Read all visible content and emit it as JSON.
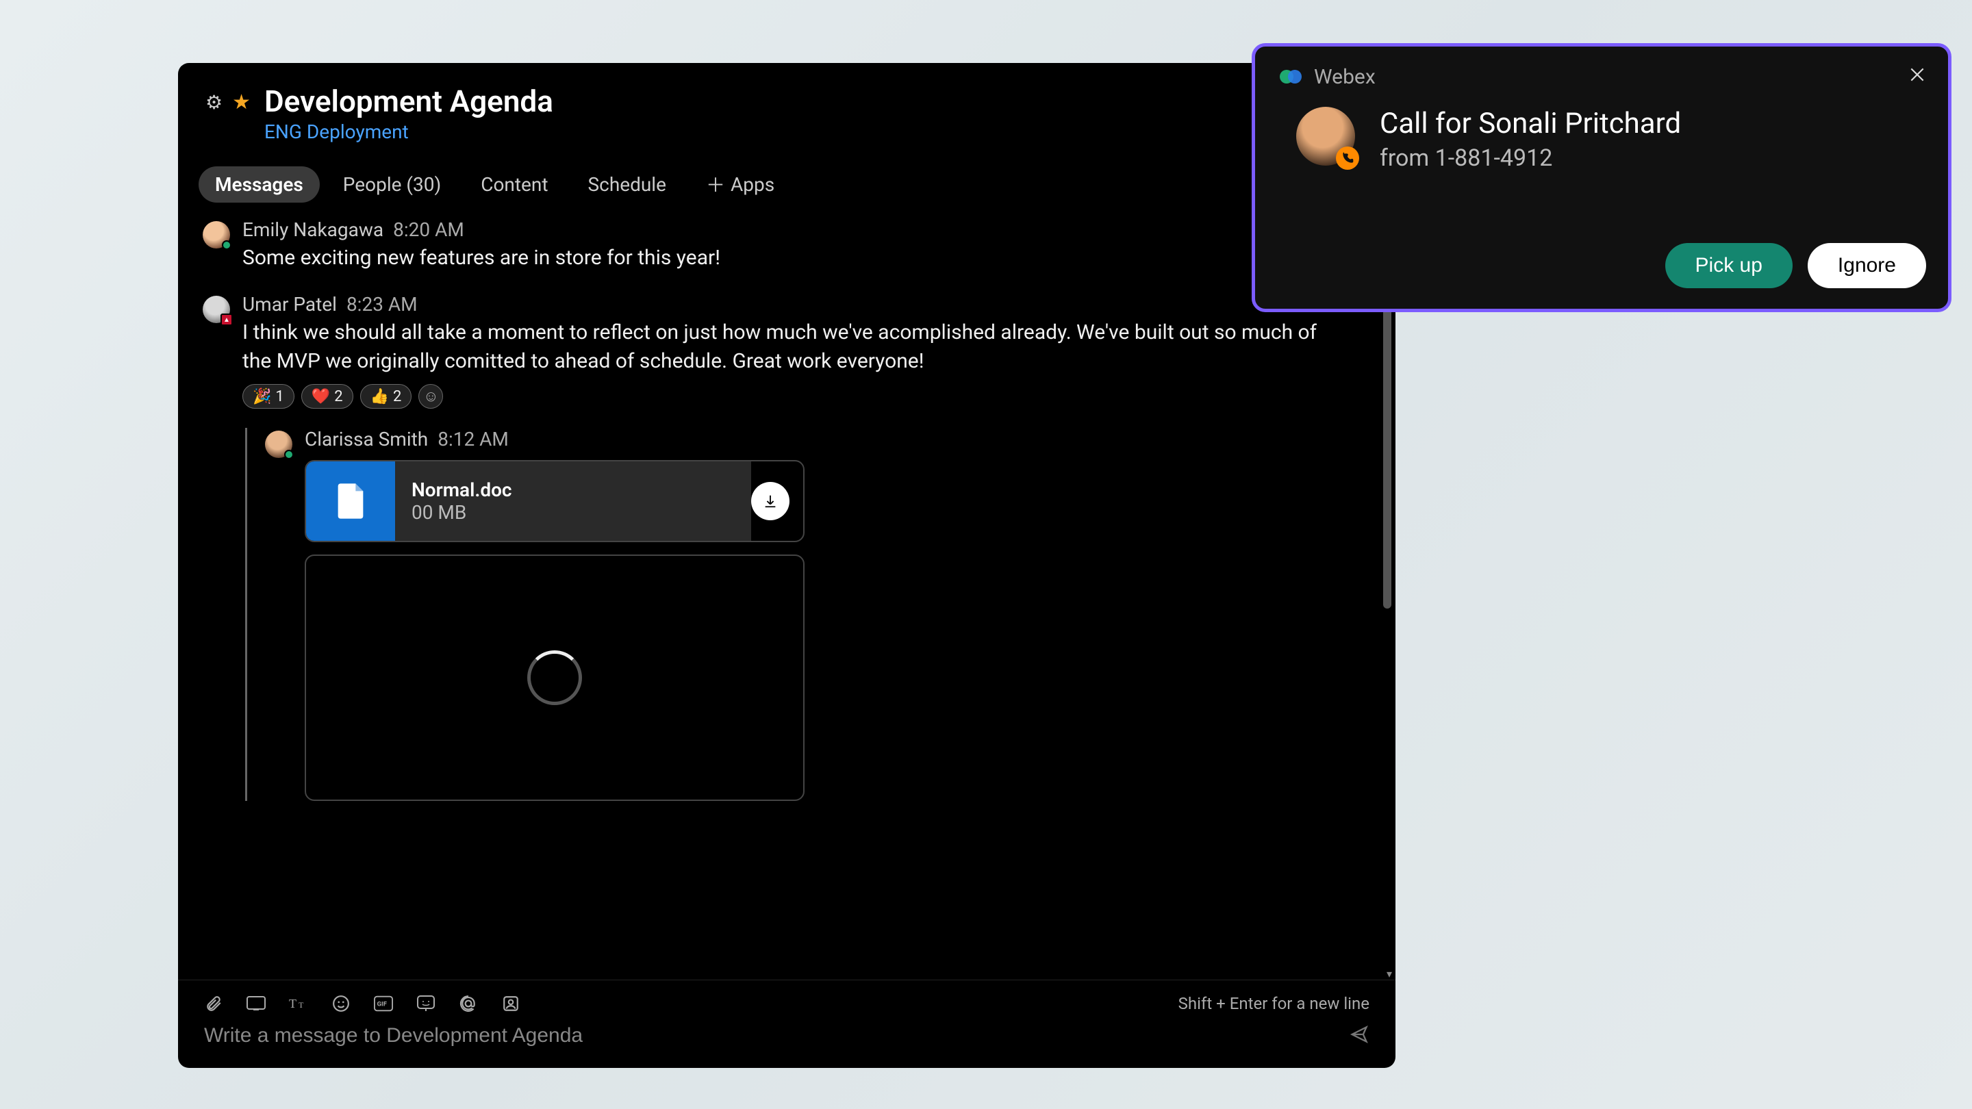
{
  "room": {
    "title": "Development Agenda",
    "subtitle": "ENG Deployment"
  },
  "tabs": {
    "messages": "Messages",
    "people": "People (30)",
    "content": "Content",
    "schedule": "Schedule",
    "apps": "Apps"
  },
  "messages": [
    {
      "author": "Emily Nakagawa",
      "time": "8:20 AM",
      "text": "Some exciting new features are in store for this year!"
    },
    {
      "author": "Umar Patel",
      "time": "8:23 AM",
      "text": "I think we should all take a moment to reflect on just how much we've acomplished already. We've built out so much of the MVP we originally comitted to ahead of schedule. Great work everyone!",
      "reactions": [
        {
          "emoji": "🎉",
          "count": "1"
        },
        {
          "emoji": "❤️",
          "count": "2"
        },
        {
          "emoji": "👍",
          "count": "2"
        }
      ]
    }
  ],
  "reply": {
    "author": "Clarissa Smith",
    "time": "8:12 AM",
    "file": {
      "name": "Normal.doc",
      "size": "00 MB"
    }
  },
  "composer": {
    "placeholder": "Write a message to Development Agenda",
    "hint": "Shift + Enter for a new line"
  },
  "call_toast": {
    "app": "Webex",
    "title": "Call for Sonali Pritchard",
    "from": "from 1-881-4912",
    "pickup": "Pick up",
    "ignore": "Ignore"
  }
}
